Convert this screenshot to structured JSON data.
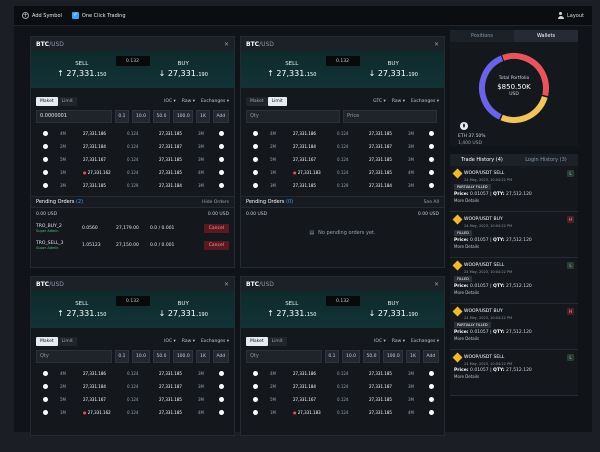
{
  "toolbar": {
    "add_symbol": "Add Symbol",
    "one_click": "One Click Trading",
    "layout": "Layout"
  },
  "panels": [
    {
      "pair_base": "BTC",
      "pair_quote": "/USD",
      "sell_label": "SELL",
      "buy_label": "BUY",
      "spread": "0.132",
      "sell_price": "27,331.",
      "sell_small": "150",
      "buy_price": "27,331.",
      "buy_small": "190",
      "toggle": [
        "Maket",
        "Limit"
      ],
      "toggle_active": 0,
      "opts": [
        "IOC ▾",
        "Raw ▾",
        "Exchanges ▾"
      ],
      "qty_value": "0.0000001",
      "qty_placeholder": "",
      "chips": [
        "0.1",
        "10.0",
        "50.0",
        "100.0",
        "1K",
        "Add"
      ],
      "book": [
        {
          "m": "4M",
          "p1": "27,331.186",
          "q": "0.124",
          "p2": "27,331.185",
          "m2": "3M",
          "dot": false
        },
        {
          "m": "2M",
          "p1": "27,331.184",
          "q": "0.124",
          "p2": "27,331.187",
          "m2": "3M",
          "dot": false
        },
        {
          "m": "5M",
          "p1": "27,331.167",
          "q": "0.124",
          "p2": "27,331.185",
          "m2": "3M",
          "dot": false
        },
        {
          "m": "1M",
          "p1": "27,331.162",
          "q": "0.124",
          "p2": "27,331.185",
          "m2": "4M",
          "dot": true
        },
        {
          "m": "3M",
          "p1": "27,331.185",
          "q": "0.129",
          "p2": "27,331.184",
          "m2": "3M",
          "dot": false
        }
      ],
      "pending_title": "Pending Orders",
      "pending_count": "(2)",
      "pending_right": "Hide Orders",
      "pend_usd_left": "0.00 USD",
      "pend_usd_right": "0.00 USD",
      "orders": [
        {
          "name": "TRO_BUY_2",
          "sub": "Super Admin",
          "a": "0.0560",
          "b": "27,179.00",
          "c": "0.0 / 0.001",
          "btn": "Cancel"
        },
        {
          "name": "TRO_SELL_3",
          "sub": "Super Admin",
          "a": "1.05123",
          "b": "27,150.00",
          "c": "0.0 / 0.001",
          "btn": "Cancel"
        }
      ]
    },
    {
      "pair_base": "BTC",
      "pair_quote": "/USD",
      "sell_label": "SELL",
      "buy_label": "BUY",
      "spread": "0.132",
      "sell_price": "27,331.",
      "sell_small": "150",
      "buy_price": "27,331.",
      "buy_small": "190",
      "toggle": [
        "Maket",
        "Limit"
      ],
      "toggle_active": 1,
      "opts": [
        "GTC ▾",
        "Raw ▾",
        "Exchanges ▾"
      ],
      "qty_placeholder": "Qty",
      "price_placeholder": "Price",
      "book": [
        {
          "m": "4M",
          "p1": "27,331.186",
          "q": "0.124",
          "p2": "27,331.185",
          "m2": "3M",
          "dot": false
        },
        {
          "m": "2M",
          "p1": "27,331.184",
          "q": "0.124",
          "p2": "27,331.187",
          "m2": "3M",
          "dot": false
        },
        {
          "m": "5M",
          "p1": "27,331.167",
          "q": "0.124",
          "p2": "27,331.185",
          "m2": "3M",
          "dot": false
        },
        {
          "m": "1M",
          "p1": "27,331.183",
          "q": "0.124",
          "p2": "27,331.185",
          "m2": "4M",
          "dot": true
        },
        {
          "m": "3M",
          "p1": "27,331.185",
          "q": "0.129",
          "p2": "27,331.184",
          "m2": "3M",
          "dot": false
        }
      ],
      "pending_title": "Pending Orders",
      "pending_count": "(0)",
      "pending_right": "See All",
      "pend_usd_left": "0.00 USD",
      "pend_usd_right": "0.00 USD",
      "no_pending": "No pending orders yet."
    },
    {
      "pair_base": "BTC",
      "pair_quote": "/USD",
      "sell_label": "SELL",
      "buy_label": "BUY",
      "spread": "0.132",
      "sell_price": "27,331.",
      "sell_small": "150",
      "buy_price": "27,331.",
      "buy_small": "190",
      "toggle": [
        "Maket",
        "Limit"
      ],
      "toggle_active": 0,
      "opts": [
        "IOC ▾",
        "Raw ▾",
        "Exchanges ▾"
      ],
      "qty_placeholder": "Qty",
      "chips": [
        "0.1",
        "10.0",
        "50.0",
        "100.0",
        "1K",
        "Add"
      ],
      "book": [
        {
          "m": "4M",
          "p1": "27,331.186",
          "q": "0.124",
          "p2": "27,331.185",
          "m2": "3M",
          "dot": false
        },
        {
          "m": "2M",
          "p1": "27,331.184",
          "q": "0.124",
          "p2": "27,331.187",
          "m2": "3M",
          "dot": false
        },
        {
          "m": "5M",
          "p1": "27,331.167",
          "q": "0.124",
          "p2": "27,331.185",
          "m2": "3M",
          "dot": false
        },
        {
          "m": "1M",
          "p1": "27,331.162",
          "q": "0.124",
          "p2": "27,331.185",
          "m2": "4M",
          "dot": true
        }
      ]
    },
    {
      "pair_base": "BTC",
      "pair_quote": "/USD",
      "sell_label": "SELL",
      "buy_label": "BUY",
      "spread": "0.132",
      "sell_price": "27,331.",
      "sell_small": "150",
      "buy_price": "27,331.",
      "buy_small": "190",
      "toggle": [
        "Maket",
        "Limit"
      ],
      "toggle_active": 0,
      "opts": [
        "IOC ▾",
        "Raw ▾",
        "Exchanges ▾"
      ],
      "qty_placeholder": "Qty",
      "chips": [
        "0.1",
        "10.0",
        "50.0",
        "100.0",
        "1K",
        "Add"
      ],
      "book": [
        {
          "m": "4M",
          "p1": "27,331.186",
          "q": "0.124",
          "p2": "27,331.185",
          "m2": "3M",
          "dot": false
        },
        {
          "m": "2M",
          "p1": "27,331.184",
          "q": "0.124",
          "p2": "27,331.187",
          "m2": "3M",
          "dot": false
        },
        {
          "m": "5M",
          "p1": "27,331.167",
          "q": "0.124",
          "p2": "27,331.185",
          "m2": "3M",
          "dot": false
        },
        {
          "m": "1M",
          "p1": "27,331.183",
          "q": "0.124",
          "p2": "27,331.185",
          "m2": "4M",
          "dot": true
        }
      ]
    }
  ],
  "right": {
    "tabs": [
      "Positions",
      "Wallets"
    ],
    "active_tab": 1,
    "portfolio_label": "Total Portfolio",
    "portfolio_value": "$850.50K",
    "portfolio_unit": "USD",
    "ring_colors": [
      "#e8545e",
      "#f2c55c",
      "#6a62e8"
    ],
    "ring_fractions": [
      0.35,
      0.275,
      0.375
    ],
    "eth_symbol": "⧫",
    "eth_label": "ETH 37.50%",
    "eth_value": "1,400 USD",
    "history_tabs": [
      "Trade History (4)",
      "Login History (3)"
    ],
    "history_active": 0,
    "trades": [
      {
        "pair": "WOOP/USDT SELL",
        "date": "24 May, 2023, 10:04:22 PM",
        "status": "PARTIALLY FILLED",
        "price": "0.01057",
        "qty": "27,512.120",
        "badge": "L",
        "more": "More Details"
      },
      {
        "pair": "WOOP/USDT BUY",
        "date": "24 May, 2023, 10:04:22 PM",
        "status": "FILLED",
        "price": "0.01057",
        "qty": "27,512.120",
        "badge": "H",
        "more": "More Details"
      },
      {
        "pair": "WOOP/USDT SELL",
        "date": "24 May, 2023, 10:04:22 PM",
        "status": "FILLED",
        "price": "0.01057",
        "qty": "27,512.120",
        "badge": "L",
        "more": "More Details"
      },
      {
        "pair": "WOOP/USDT BUY",
        "date": "24 May, 2023, 10:04:22 PM",
        "status": "PARTIALLY FILLED",
        "price": "0.01057",
        "qty": "27,512.120",
        "badge": "H",
        "more": "More Details"
      },
      {
        "pair": "WOOP/USDT SELL",
        "date": "24 May, 2023, 10:04:22 PM",
        "status": "",
        "price": "0.01057",
        "qty": "27,512.120",
        "badge": "L",
        "more": "More Details"
      }
    ],
    "price_key": "Price:",
    "qty_key": "QTY:"
  }
}
